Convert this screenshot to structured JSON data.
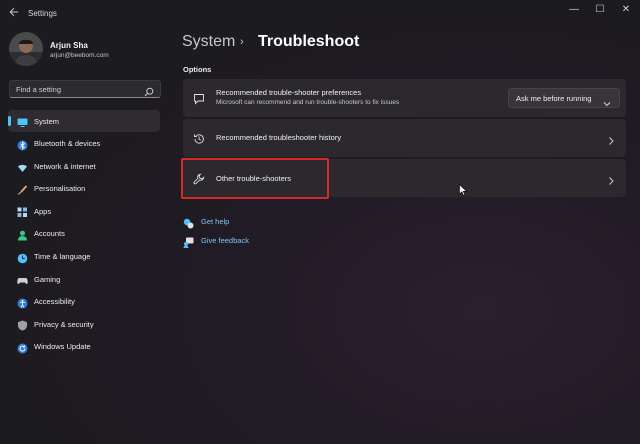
{
  "window": {
    "title": "Settings",
    "controls": {
      "minimize": "—",
      "maximize": "☐",
      "close": "✕"
    }
  },
  "profile": {
    "name": "Arjun Sha",
    "email": "arjun@beebom.com"
  },
  "search": {
    "placeholder": "Find a setting"
  },
  "sidebar": {
    "items": [
      {
        "label": "System",
        "icon": "monitor-icon",
        "active": true,
        "color": "#4cc2ff"
      },
      {
        "label": "Bluetooth & devices",
        "icon": "bluetooth-icon",
        "color": "#4cc2ff"
      },
      {
        "label": "Network & internet",
        "icon": "wifi-icon",
        "color": "#a9d8f5"
      },
      {
        "label": "Personalisation",
        "icon": "brush-icon",
        "color": "#f1a36b"
      },
      {
        "label": "Apps",
        "icon": "apps-icon",
        "color": "#b9d9f0"
      },
      {
        "label": "Accounts",
        "icon": "person-icon",
        "color": "#36c98d"
      },
      {
        "label": "Time & language",
        "icon": "globe-clock-icon",
        "color": "#4cc2ff"
      },
      {
        "label": "Gaming",
        "icon": "gamepad-icon",
        "color": "#cfcfcf"
      },
      {
        "label": "Accessibility",
        "icon": "accessibility-icon",
        "color": "#4cc2ff"
      },
      {
        "label": "Privacy & security",
        "icon": "shield-icon",
        "color": "#a0a0a8"
      },
      {
        "label": "Windows Update",
        "icon": "update-icon",
        "color": "#4cc2ff"
      }
    ]
  },
  "main": {
    "breadcrumb": {
      "parent": "System",
      "separator": "›",
      "current": "Troubleshoot"
    },
    "section_label": "Options",
    "cards": [
      {
        "title": "Recommended trouble-shooter preferences",
        "subtitle": "Microsoft can recommend and run trouble-shooters to fix issues",
        "icon": "chat-icon",
        "dropdown": "Ask me before running"
      },
      {
        "title": "Recommended troubleshooter history",
        "icon": "history-icon"
      },
      {
        "title": "Other trouble-shooters",
        "icon": "wrench-icon",
        "highlighted": true
      }
    ],
    "links": [
      {
        "label": "Get help",
        "icon": "help-icon"
      },
      {
        "label": "Give feedback",
        "icon": "feedback-icon"
      }
    ]
  },
  "colors": {
    "accent": "#4cc2ff",
    "link": "#7fc6f2",
    "highlight": "#d42a2a",
    "card": "#2b292d"
  }
}
